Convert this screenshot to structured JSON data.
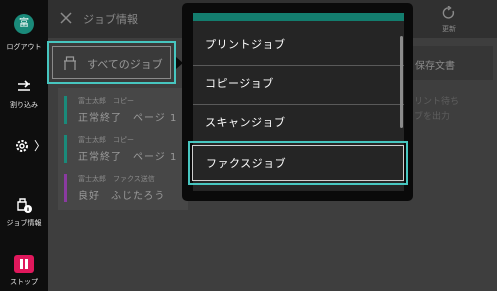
{
  "sidebar": {
    "logout": {
      "avatar_char": "富",
      "label": "ログアウト",
      "avatar_color": "#1a8a7a"
    },
    "interrupt": {
      "label": "割り込み"
    },
    "settings": {
      "chevron": "〉"
    },
    "job_info": {
      "label": "ジョブ情報"
    },
    "stop": {
      "label": "ストップ",
      "color": "#e0185c"
    }
  },
  "header": {
    "title": "ジョブ情報",
    "refresh_label": "更新"
  },
  "filter": {
    "label": "すべてのジョブ"
  },
  "right_panel": {
    "stored_docs_label": "保存文書",
    "print_wait_line1": "リント待ち",
    "print_wait_line2": "ブを出力"
  },
  "jobs": [
    {
      "meta": "富士太郎　コピー",
      "status": "正常終了　ページ 1",
      "color": "#1a8a7a"
    },
    {
      "meta": "富士太郎　コピー",
      "status": "正常終了　ページ 1",
      "color": "#1a8a7a"
    },
    {
      "meta": "富士太郎　ファクス送信",
      "status": "良好　ふじたろう",
      "color": "#8a3aa0"
    }
  ],
  "dropdown": {
    "accent_color": "#137d6e",
    "items": [
      {
        "label": "プリントジョブ"
      },
      {
        "label": "コピージョブ"
      },
      {
        "label": "スキャンジョブ"
      },
      {
        "label": "ファクスジョブ",
        "selected": true
      }
    ]
  },
  "colors": {
    "highlight": "#47c6c0"
  }
}
